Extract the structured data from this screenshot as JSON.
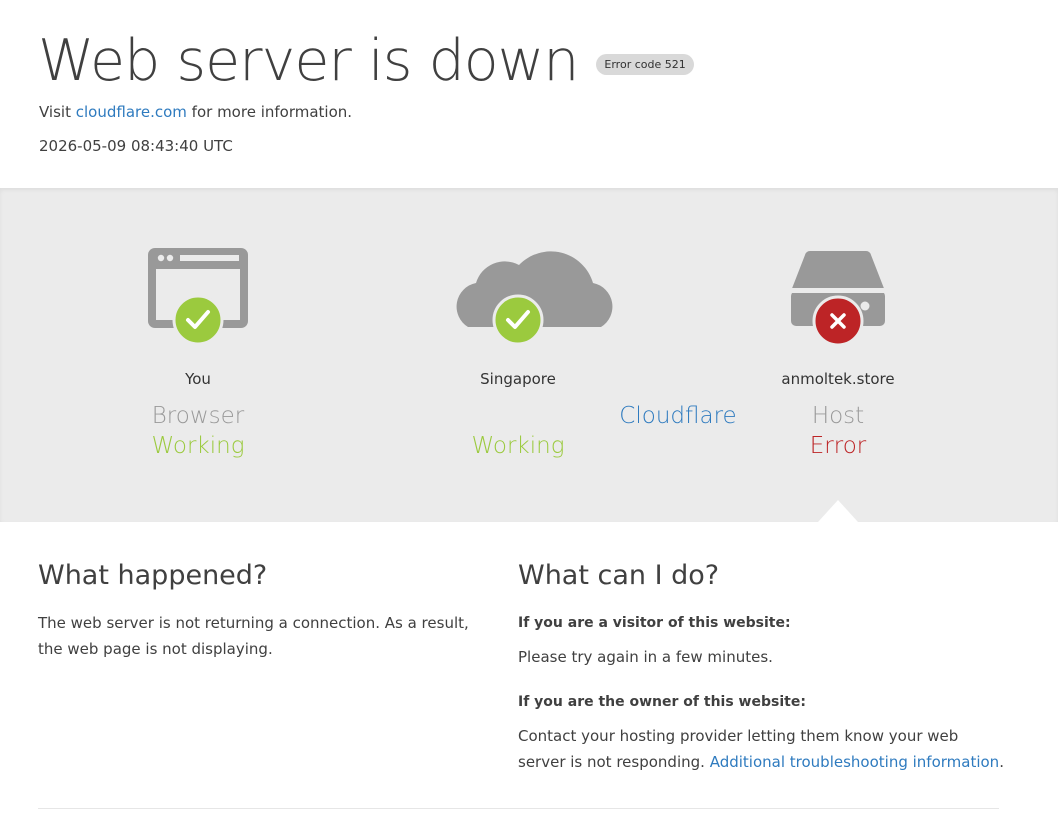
{
  "header": {
    "title": "Web server is down",
    "error_code": "Error code 521",
    "visit_prefix": "Visit",
    "visit_link": "cloudflare.com",
    "visit_suffix": "for more information.",
    "timestamp": "2026-05-09 08:43:40 UTC"
  },
  "status": {
    "nodes": [
      {
        "location": "You",
        "label": "Browser",
        "status": "Working",
        "icon": "browser-icon",
        "badge": "check-icon"
      },
      {
        "location": "Singapore",
        "label": "Cloudflare",
        "status": "Working",
        "icon": "cloud-icon",
        "badge": "check-icon"
      },
      {
        "location": "anmoltek.store",
        "label": "Host",
        "status": "Error",
        "icon": "server-icon",
        "badge": "x-icon"
      }
    ],
    "colors": {
      "working": "#9bca3e",
      "error": "#bd2426",
      "link": "#2f7bbf",
      "icon_gray": "#999999"
    }
  },
  "what_happened": {
    "heading": "What happened?",
    "body": "The web server is not returning a connection. As a result, the web page is not displaying."
  },
  "what_can_i_do": {
    "heading": "What can I do?",
    "visitor_heading": "If you are a visitor of this website:",
    "visitor_body": "Please try again in a few minutes.",
    "owner_heading": "If you are the owner of this website:",
    "owner_body": "Contact your hosting provider letting them know your web server is not responding.",
    "owner_link": "Additional troubleshooting information",
    "owner_suffix": "."
  }
}
